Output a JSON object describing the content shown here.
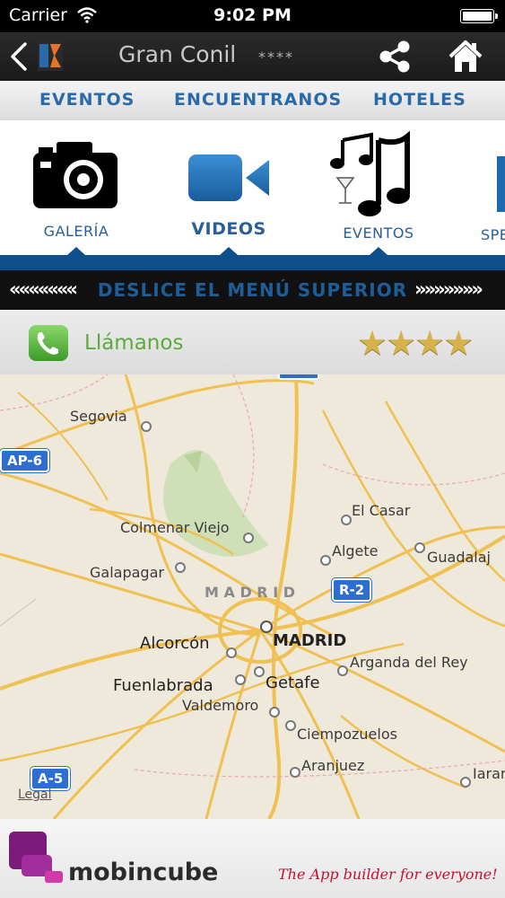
{
  "status_bar": {
    "carrier": "Carrier",
    "time": "9:02 PM"
  },
  "nav": {
    "title": "Gran Conil",
    "stars": "****",
    "icons": [
      "back-icon",
      "app-logo",
      "share-icon",
      "home-icon"
    ]
  },
  "tabs": [
    "EVENTOS",
    "ENCUENTRANOS",
    "HOTELES"
  ],
  "menu": [
    {
      "label": "GALERÍA",
      "icon": "camera-icon"
    },
    {
      "label": "VIDEOS",
      "icon": "video-camera-icon"
    },
    {
      "label": "EVENTOS",
      "icon": "music-notes-icon"
    },
    {
      "label": "SPE",
      "icon": "partial-icon"
    }
  ],
  "swipe_banner": {
    "text": "DESLICE EL MENÚ SUPERIOR",
    "left": "«««««««",
    "right": "»»»»»»»"
  },
  "call": {
    "label": "Llámanos",
    "rating": "★★★★"
  },
  "map": {
    "places": [
      "Segovia",
      "El Casar",
      "Colmenar Viejo",
      "Algete",
      "Guadalaj",
      "Galapagar",
      "M A D R I D",
      "MADRID",
      "Alcorcón",
      "Arganda del Rey",
      "Fuenlabrada",
      "Getafe",
      "Valdemoro",
      "Ciempozuelos",
      "Aranjuez",
      "Iarar"
    ],
    "shields": [
      "AP-6",
      "R-2",
      "A-5"
    ],
    "legal": "Legal"
  },
  "footer": {
    "brand": "mobincube",
    "tagline": "The App builder for everyone!"
  }
}
